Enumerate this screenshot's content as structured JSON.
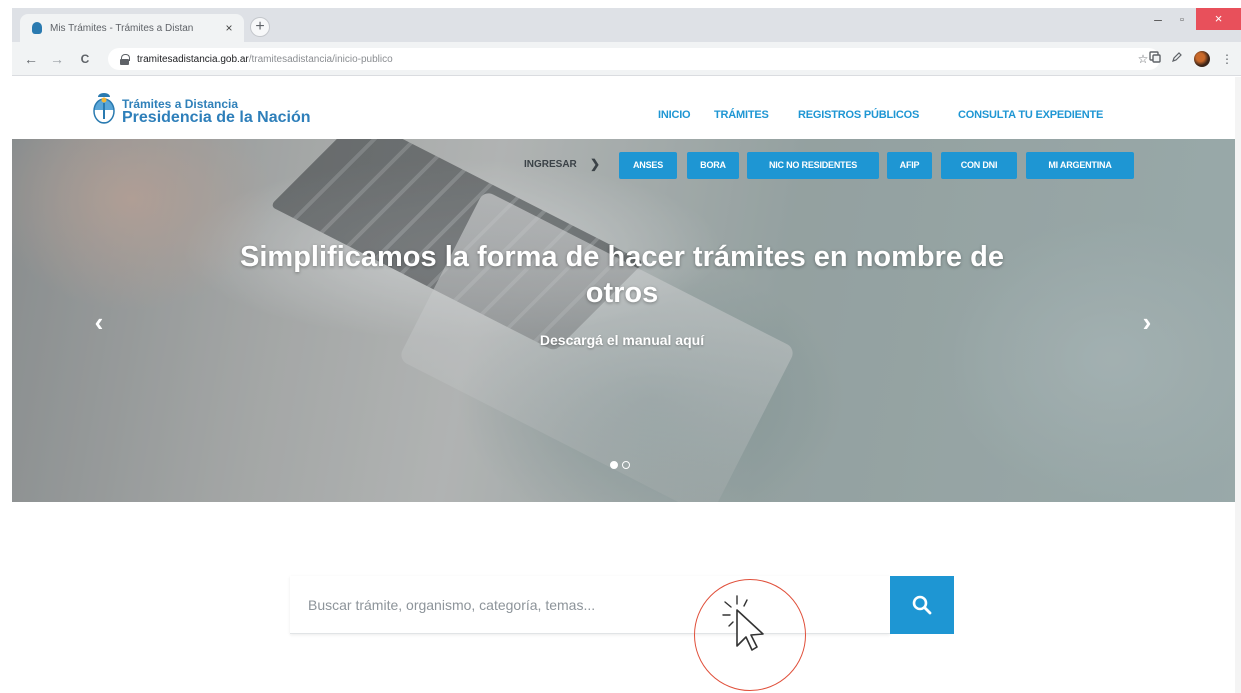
{
  "browser": {
    "tab_title": "Mis Trámites - Trámites a Distan",
    "tab_close": "×",
    "new_tab": "+",
    "window_minimize": "–",
    "window_maximize": "▫",
    "window_close": "×",
    "nav_back": "←",
    "nav_forward": "→",
    "nav_reload": "C",
    "url_host": "tramitesadistancia.gob.ar",
    "url_path": "/tramitesadistancia/inicio-publico",
    "star": "☆",
    "icons": [
      "back-arrow-icon",
      "forward-arrow-icon",
      "reload-icon",
      "lock-icon",
      "star-icon",
      "extension-icon",
      "pen-icon",
      "profile-avatar-icon"
    ]
  },
  "site": {
    "logo_line1": "Trámites a Distancia",
    "logo_line2": "Presidencia de la Nación",
    "nav": [
      "INICIO",
      "TRÁMITES",
      "REGISTROS PÚBLICOS",
      "CONSULTA TU EXPEDIENTE"
    ]
  },
  "hero": {
    "ingresar_label": "INGRESAR",
    "ingresar_arrow": "❯",
    "quick_links": [
      "ANSES",
      "BORA",
      "NIC NO RESIDENTES",
      "AFIP",
      "CON DNI",
      "MI ARGENTINA"
    ],
    "title": "Simplificamos la forma de hacer trámites en nombre de otros",
    "link_text": "Descargá el manual aquí",
    "prev_arrow": "‹",
    "next_arrow": "›",
    "slides_total": 2,
    "active_slide": 1
  },
  "search": {
    "placeholder": "Buscar trámite, organismo, categoría, temas..."
  },
  "colors": {
    "accent": "#1e96d3",
    "logo_blue": "#2e7fba",
    "annotation": "#e0503b"
  }
}
